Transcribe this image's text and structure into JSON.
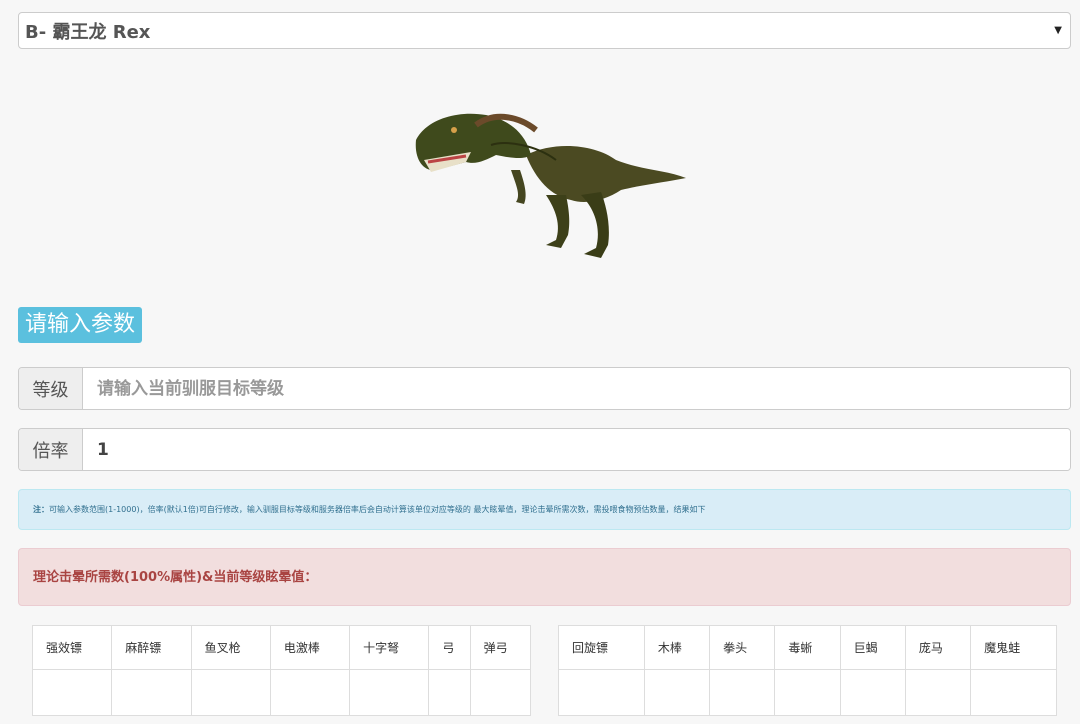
{
  "creature_select": {
    "selected": "B- 霸王龙 Rex"
  },
  "section_title": "请输入参数",
  "level": {
    "label": "等级",
    "placeholder": "请输入当前驯服目标等级",
    "value": ""
  },
  "multiplier": {
    "label": "倍率",
    "value": "1"
  },
  "note": {
    "prefix": "注：",
    "text": "可输入参数范围(1-1000)，倍率(默认1倍)可自行修改，输入驯服目标等级和服务器倍率后会自动计算该单位对应等级的 最大眩晕值，理论击晕所需次数，需投喂食物预估数量，结果如下"
  },
  "result_title": "理论击晕所需数(100%属性)&当前等级眩晕值：",
  "table_left": {
    "headers": [
      "强效镖",
      "麻醉镖",
      "鱼叉枪",
      "电激棒",
      "十字弩",
      "弓",
      "弹弓"
    ],
    "values": [
      "",
      "",
      "",
      "",
      "",
      "",
      ""
    ]
  },
  "table_right": {
    "headers": [
      "回旋镖",
      "木棒",
      "拳头",
      "毒蜥",
      "巨蝎",
      "庞马",
      "魔鬼蛙"
    ],
    "values": [
      "",
      "",
      "",
      "",
      "",
      "",
      ""
    ]
  }
}
